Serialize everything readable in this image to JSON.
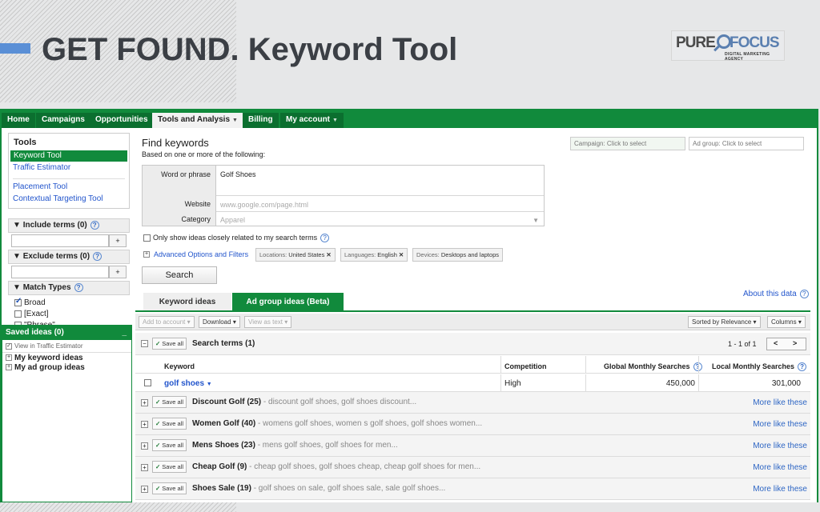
{
  "slide": {
    "title": "GET FOUND. Keyword Tool",
    "logo": {
      "pure": "PURE",
      "focus": "FOCUS",
      "tagline": "DIGITAL MARKETING AGENCY"
    }
  },
  "nav": {
    "tabs": [
      {
        "label": "Home"
      },
      {
        "label": "Campaigns"
      },
      {
        "label": "Opportunities"
      },
      {
        "label": "Tools and Analysis"
      },
      {
        "label": "Billing"
      },
      {
        "label": "My account"
      }
    ],
    "active_tab": "Tools and Analysis"
  },
  "sidebar": {
    "tools_title": "Tools",
    "tools": [
      "Keyword Tool",
      "Traffic Estimator",
      "Placement Tool",
      "Contextual Targeting Tool"
    ],
    "include_terms": "Include terms (0)",
    "exclude_terms": "Exclude terms (0)",
    "add_button": "+",
    "match_types": "Match Types",
    "match_options": [
      {
        "label": "Broad",
        "checked": true
      },
      {
        "label": "[Exact]",
        "checked": false
      },
      {
        "label": "\"Phrase\"",
        "checked": false
      }
    ],
    "saved": {
      "title": "Saved ideas (0)",
      "minimize": "_",
      "view_traffic": "View in Traffic Estimator",
      "items": [
        "My keyword ideas",
        "My ad group ideas"
      ]
    }
  },
  "find": {
    "title": "Find keywords",
    "subtitle": "Based on one or more of the following:",
    "campaign_placeholder": "Campaign: Click to select",
    "adgroup_placeholder": "Ad group: Click to select",
    "fields": {
      "word_label": "Word or phrase",
      "word_value": "Golf Shoes",
      "website_label": "Website",
      "website_placeholder": "www.google.com/page.html",
      "category_label": "Category",
      "category_placeholder": "Apparel"
    },
    "only_show": "Only show ideas closely related to my search terms",
    "advanced": "Advanced Options and Filters",
    "chips": [
      {
        "key": "Locations:",
        "value": "United States",
        "removable": true
      },
      {
        "key": "Languages:",
        "value": "English",
        "removable": true
      },
      {
        "key": "Devices:",
        "value": "Desktops and laptops",
        "removable": false
      }
    ],
    "search_button": "Search"
  },
  "results": {
    "about": "About this data",
    "tabs": [
      "Keyword ideas",
      "Ad group ideas (Beta)"
    ],
    "active_tab": "Ad group ideas (Beta)",
    "toolbar": {
      "add_to_account": "Add to account",
      "download": "Download",
      "view_as_text": "View as text",
      "sorted": "Sorted by Relevance",
      "columns": "Columns"
    },
    "search_terms": {
      "save_label": "Save all",
      "title": "Search terms (1)",
      "pager": "1 - 1 of 1",
      "prev": "<",
      "next": ">"
    },
    "columns": [
      "Keyword",
      "Competition",
      "Global Monthly Searches",
      "Local Monthly Searches"
    ],
    "rows": [
      {
        "keyword": "golf shoes",
        "competition": "High",
        "global": "450,000",
        "local": "301,000"
      }
    ],
    "more_like": "More like these",
    "groups": [
      {
        "name": "Discount Golf (25)",
        "desc": "- discount golf shoes, golf shoes discount..."
      },
      {
        "name": "Women Golf (40)",
        "desc": "- womens golf shoes, women s golf shoes, golf shoes women..."
      },
      {
        "name": "Mens Shoes (23)",
        "desc": "- mens golf shoes, golf shoes for men..."
      },
      {
        "name": "Cheap Golf (9)",
        "desc": "- cheap golf shoes, golf shoes cheap, cheap golf shoes for men..."
      },
      {
        "name": "Shoes Sale (19)",
        "desc": "- golf shoes on sale, golf shoes sale, sale golf shoes..."
      }
    ]
  },
  "colors": {
    "brand_green": "#118a3c",
    "link_blue": "#2255cc",
    "title_gray": "#3b3f45",
    "accent_blue": "#5a8fd6"
  }
}
